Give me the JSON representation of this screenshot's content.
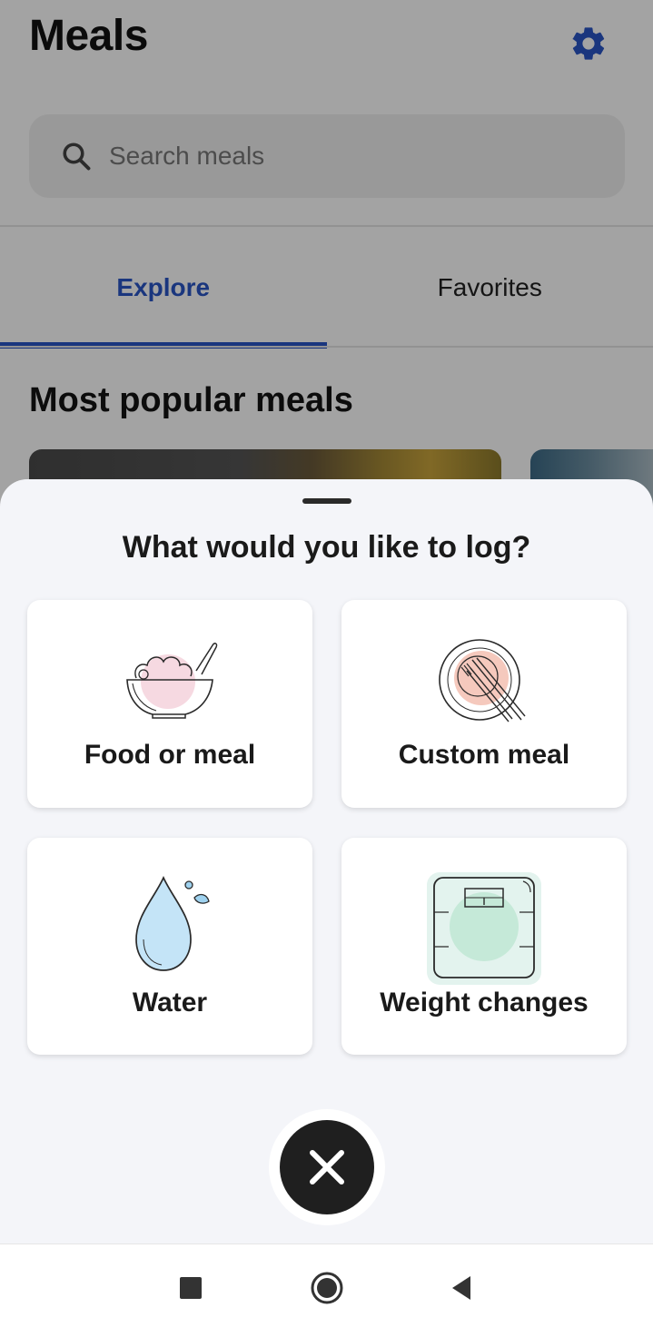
{
  "app": {
    "title": "Meals",
    "settings_icon": "gear-icon",
    "accent_color": "#2a55c5",
    "search": {
      "placeholder": "Search meals",
      "value": ""
    },
    "tabs": [
      {
        "label": "Explore",
        "active": true
      },
      {
        "label": "Favorites",
        "active": false
      }
    ],
    "section_title": "Most popular meals"
  },
  "sheet": {
    "title": "What would you like to log?",
    "options": [
      {
        "label": "Food or meal",
        "icon": "bowl-icon"
      },
      {
        "label": "Custom meal",
        "icon": "plate-icon"
      },
      {
        "label": "Water",
        "icon": "water-drop-icon"
      },
      {
        "label": "Weight changes",
        "icon": "scale-icon"
      }
    ],
    "close_icon": "close-icon"
  },
  "navbar": {
    "items": [
      {
        "name": "recents",
        "icon": "square-icon"
      },
      {
        "name": "home",
        "icon": "circle-icon"
      },
      {
        "name": "back",
        "icon": "triangle-icon"
      }
    ]
  }
}
